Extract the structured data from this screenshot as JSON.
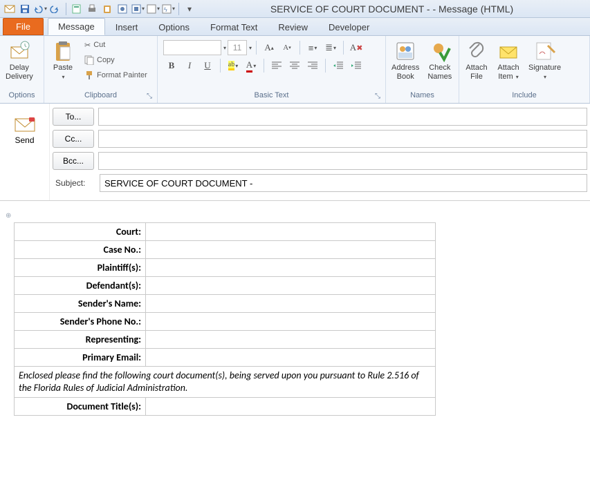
{
  "window": {
    "title": "SERVICE OF COURT DOCUMENT -  - Message (HTML)"
  },
  "tabs": {
    "file": "File",
    "message": "Message",
    "insert": "Insert",
    "options": "Options",
    "format": "Format Text",
    "review": "Review",
    "developer": "Developer"
  },
  "ribbon": {
    "options": {
      "delay1": "Delay",
      "delay2": "Delivery",
      "group_label": "Options"
    },
    "clipboard": {
      "paste": "Paste",
      "cut": "Cut",
      "copy": "Copy",
      "fp": "Format Painter",
      "group_label": "Clipboard"
    },
    "basictext": {
      "font_placeholder": "",
      "size": "11",
      "group_label": "Basic Text"
    },
    "names": {
      "abook1": "Address",
      "abook2": "Book",
      "check1": "Check",
      "check2": "Names",
      "group_label": "Names"
    },
    "include": {
      "afile1": "Attach",
      "afile2": "File",
      "aitem1": "Attach",
      "aitem2": "Item",
      "sig": "Signature",
      "group_label": "Include"
    }
  },
  "compose": {
    "send": "Send",
    "to": "To...",
    "cc": "Cc...",
    "bcc": "Bcc...",
    "subject_label": "Subject:",
    "subject_value": "SERVICE OF COURT DOCUMENT - "
  },
  "body": {
    "rows": {
      "court": "Court:",
      "caseno": "Case No.:",
      "plaintiffs": "Plaintiff(s):",
      "defendants": "Defendant(s):",
      "sender_name": "Sender's Name:",
      "sender_phone": "Sender's Phone No.:",
      "representing": "Representing:",
      "primary_email": "Primary Email:"
    },
    "paragraph": "Enclosed please find  the following court document(s), being served upon you pursuant to Rule 2.516 of the Florida Rules of Judicial Administration.",
    "doc_titles": "Document Title(s):"
  }
}
